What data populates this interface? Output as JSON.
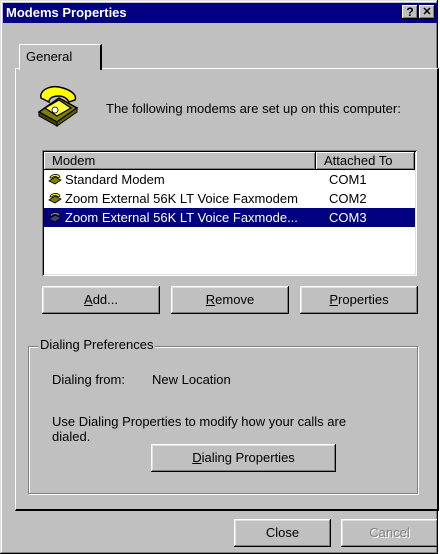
{
  "window": {
    "title": "Modems Properties",
    "help_label": "?",
    "close_label": "✕"
  },
  "tabs": [
    {
      "label": "General"
    }
  ],
  "intro_text": "The following modems are set up on this computer:",
  "modem_list": {
    "columns": [
      "Modem",
      "Attached To"
    ],
    "rows": [
      {
        "name": "Standard Modem",
        "port": "COM1",
        "selected": false
      },
      {
        "name": "Zoom External 56K LT Voice Faxmodem",
        "port": "COM2",
        "selected": false
      },
      {
        "name": "Zoom External 56K LT Voice Faxmode...",
        "port": "COM3",
        "selected": true
      }
    ]
  },
  "buttons": {
    "add_prefix": "A",
    "add_rest": "dd...",
    "remove_prefix": "R",
    "remove_rest": "emove",
    "properties_prefix": "P",
    "properties_rest": "roperties"
  },
  "dialing": {
    "group_label": "Dialing Preferences",
    "from_label": "Dialing from:",
    "from_value": "New Location",
    "info_line1": "Use Dialing Properties to modify how your calls are",
    "info_line2": "dialed.",
    "button_prefix": "D",
    "button_rest": "ialing Properties"
  },
  "footer": {
    "close_label": "Close",
    "cancel_label": "Cancel"
  },
  "colors": {
    "selection": "#000080",
    "face": "#c0c0c0",
    "titlebar": "#000080"
  },
  "icons": [
    "telephone-icon",
    "modem-icon"
  ]
}
